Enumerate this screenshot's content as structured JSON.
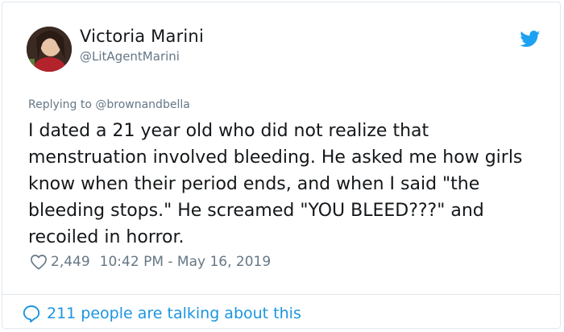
{
  "author": {
    "display_name": "Victoria Marini",
    "handle": "@LitAgentMarini",
    "avatar_icon": "profile-photo"
  },
  "reply": {
    "prefix": "Replying to ",
    "handle": "@brownandbella",
    "full": "Replying to @brownandbella"
  },
  "tweet": {
    "text": "I dated a 21 year old who did not realize that menstruation involved bleeding. He asked me how girls know when their period ends, and when I said \"the bleeding stops.\" He screamed \"YOU BLEED???\" and recoiled in horror."
  },
  "meta": {
    "likes": "2,449",
    "timestamp": "10:42 PM - May 16, 2019"
  },
  "footer": {
    "talking_label": "211 people are talking about this"
  },
  "colors": {
    "twitter_blue": "#1da1f2",
    "link_blue": "#1b95e0",
    "secondary_text": "#657786",
    "primary_text": "#14171a",
    "border": "#e1e8ed"
  },
  "icons": {
    "brand": "twitter-bird-icon",
    "like": "heart-outline-icon",
    "talking": "speech-bubble-icon"
  }
}
